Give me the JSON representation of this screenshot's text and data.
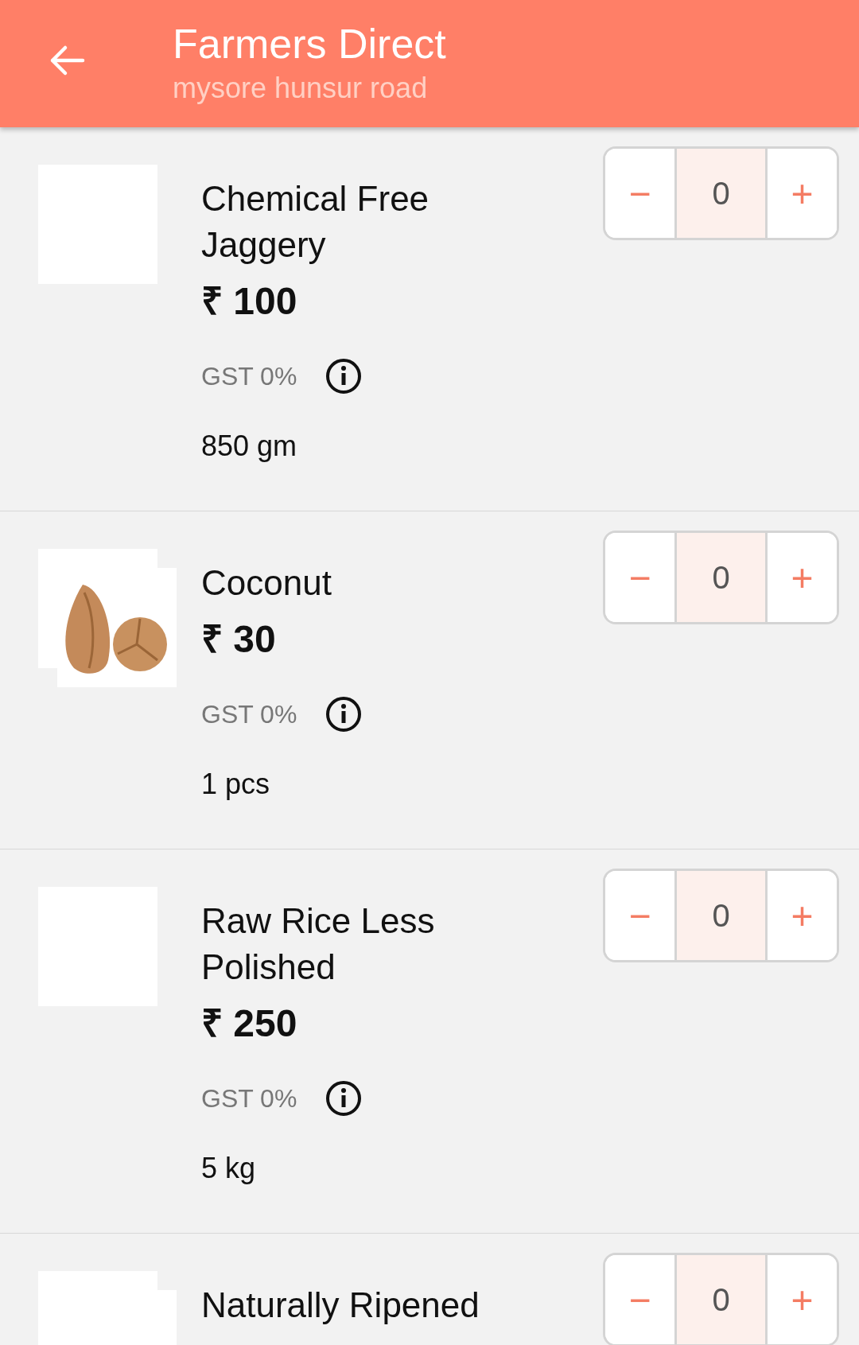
{
  "header": {
    "title": "Farmers Direct",
    "subtitle": "mysore hunsur road"
  },
  "products": [
    {
      "name": "Chemical Free Jaggery",
      "has_photo": false,
      "price": "₹ 100",
      "gst": "GST 0%",
      "quantity_unit": "850 gm",
      "count": "0",
      "minus": "−",
      "plus": "+"
    },
    {
      "name": "Coconut",
      "has_photo": true,
      "price": "₹ 30",
      "gst": "GST 0%",
      "quantity_unit": "1 pcs",
      "count": "0",
      "minus": "−",
      "plus": "+"
    },
    {
      "name": "Raw Rice Less Polished",
      "has_photo": false,
      "price": "₹ 250",
      "gst": "GST 0%",
      "quantity_unit": "5 kg",
      "count": "0",
      "minus": "−",
      "plus": "+"
    },
    {
      "name": "Naturally Ripened",
      "has_photo": true,
      "count": "0",
      "minus": "−",
      "plus": "+"
    }
  ]
}
